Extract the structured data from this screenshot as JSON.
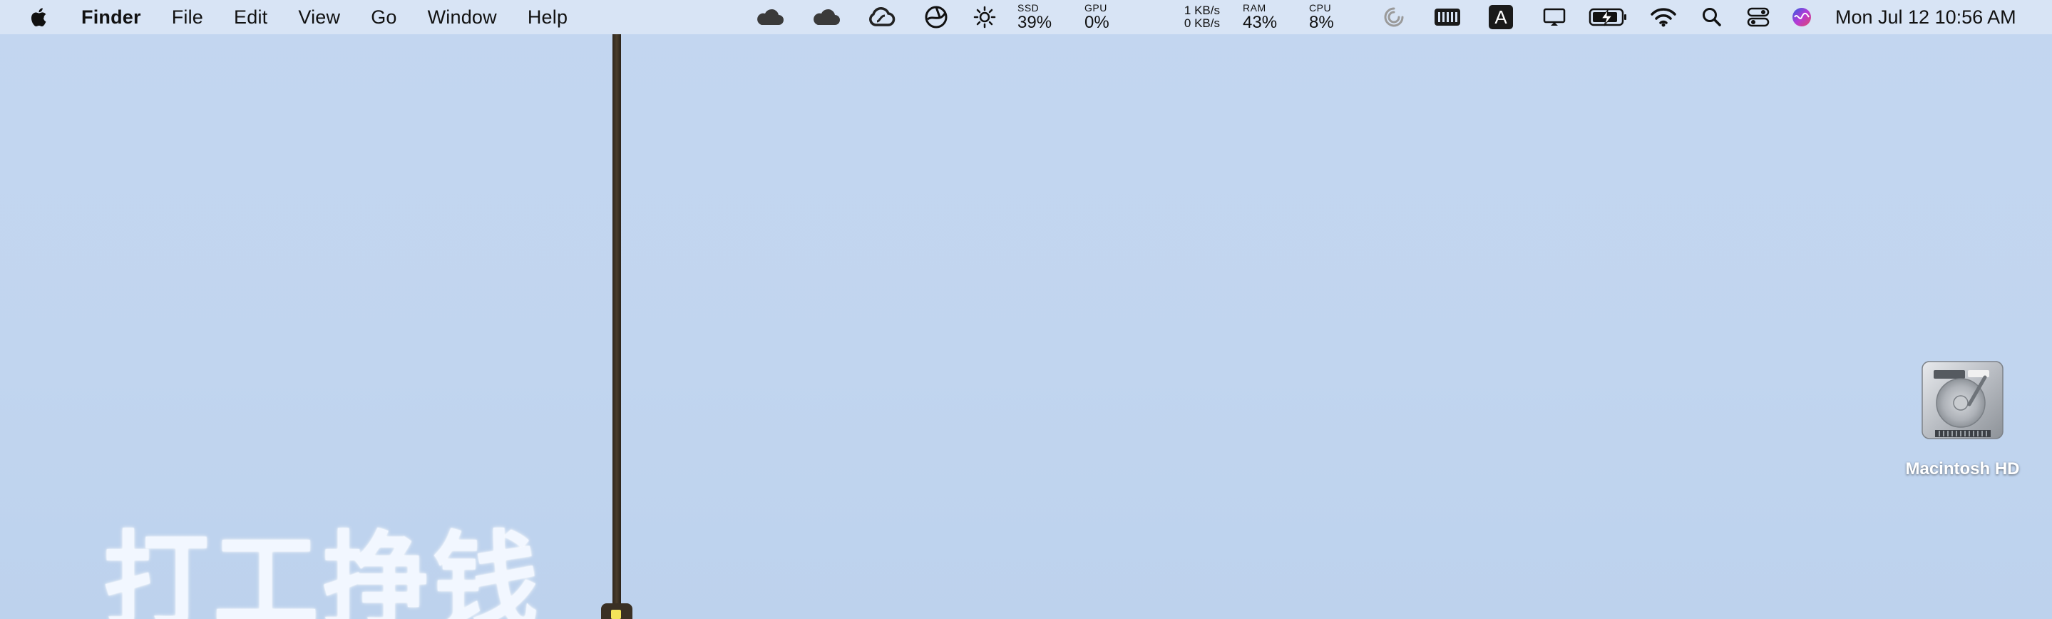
{
  "menubar": {
    "app_name": "Finder",
    "menus": [
      "File",
      "Edit",
      "View",
      "Go",
      "Window",
      "Help"
    ],
    "icons": {
      "apple": "apple-logo-icon",
      "cloud1": "cloud-icon",
      "cloud2": "cloud-icon",
      "creative_cloud": "creative-cloud-icon",
      "vpn": "vpn-globe-icon",
      "brightness": "brightness-icon",
      "spiral": "spiral-icon",
      "battery_meter": "battery-meter-icon",
      "keyboard_input": "input-source-icon",
      "display": "display-icon",
      "battery": "battery-charging-icon",
      "wifi": "wifi-icon",
      "search": "spotlight-search-icon",
      "control_center": "control-center-icon",
      "siri": "siri-icon"
    },
    "stats": {
      "ssd": {
        "label": "SSD",
        "value": "39%"
      },
      "gpu": {
        "label": "GPU",
        "value": "0%"
      },
      "network": {
        "up": "1 KB/s",
        "down": "0 KB/s"
      },
      "ram": {
        "label": "RAM",
        "value": "43%"
      },
      "cpu": {
        "label": "CPU",
        "value": "8%"
      }
    },
    "input_source_letter": "A",
    "clock": "Mon Jul 12  10:56 AM"
  },
  "desktop": {
    "slogan": "打工挣钱",
    "drive_label": "Macintosh HD",
    "wallpaper_color": "#c1d5ef"
  }
}
